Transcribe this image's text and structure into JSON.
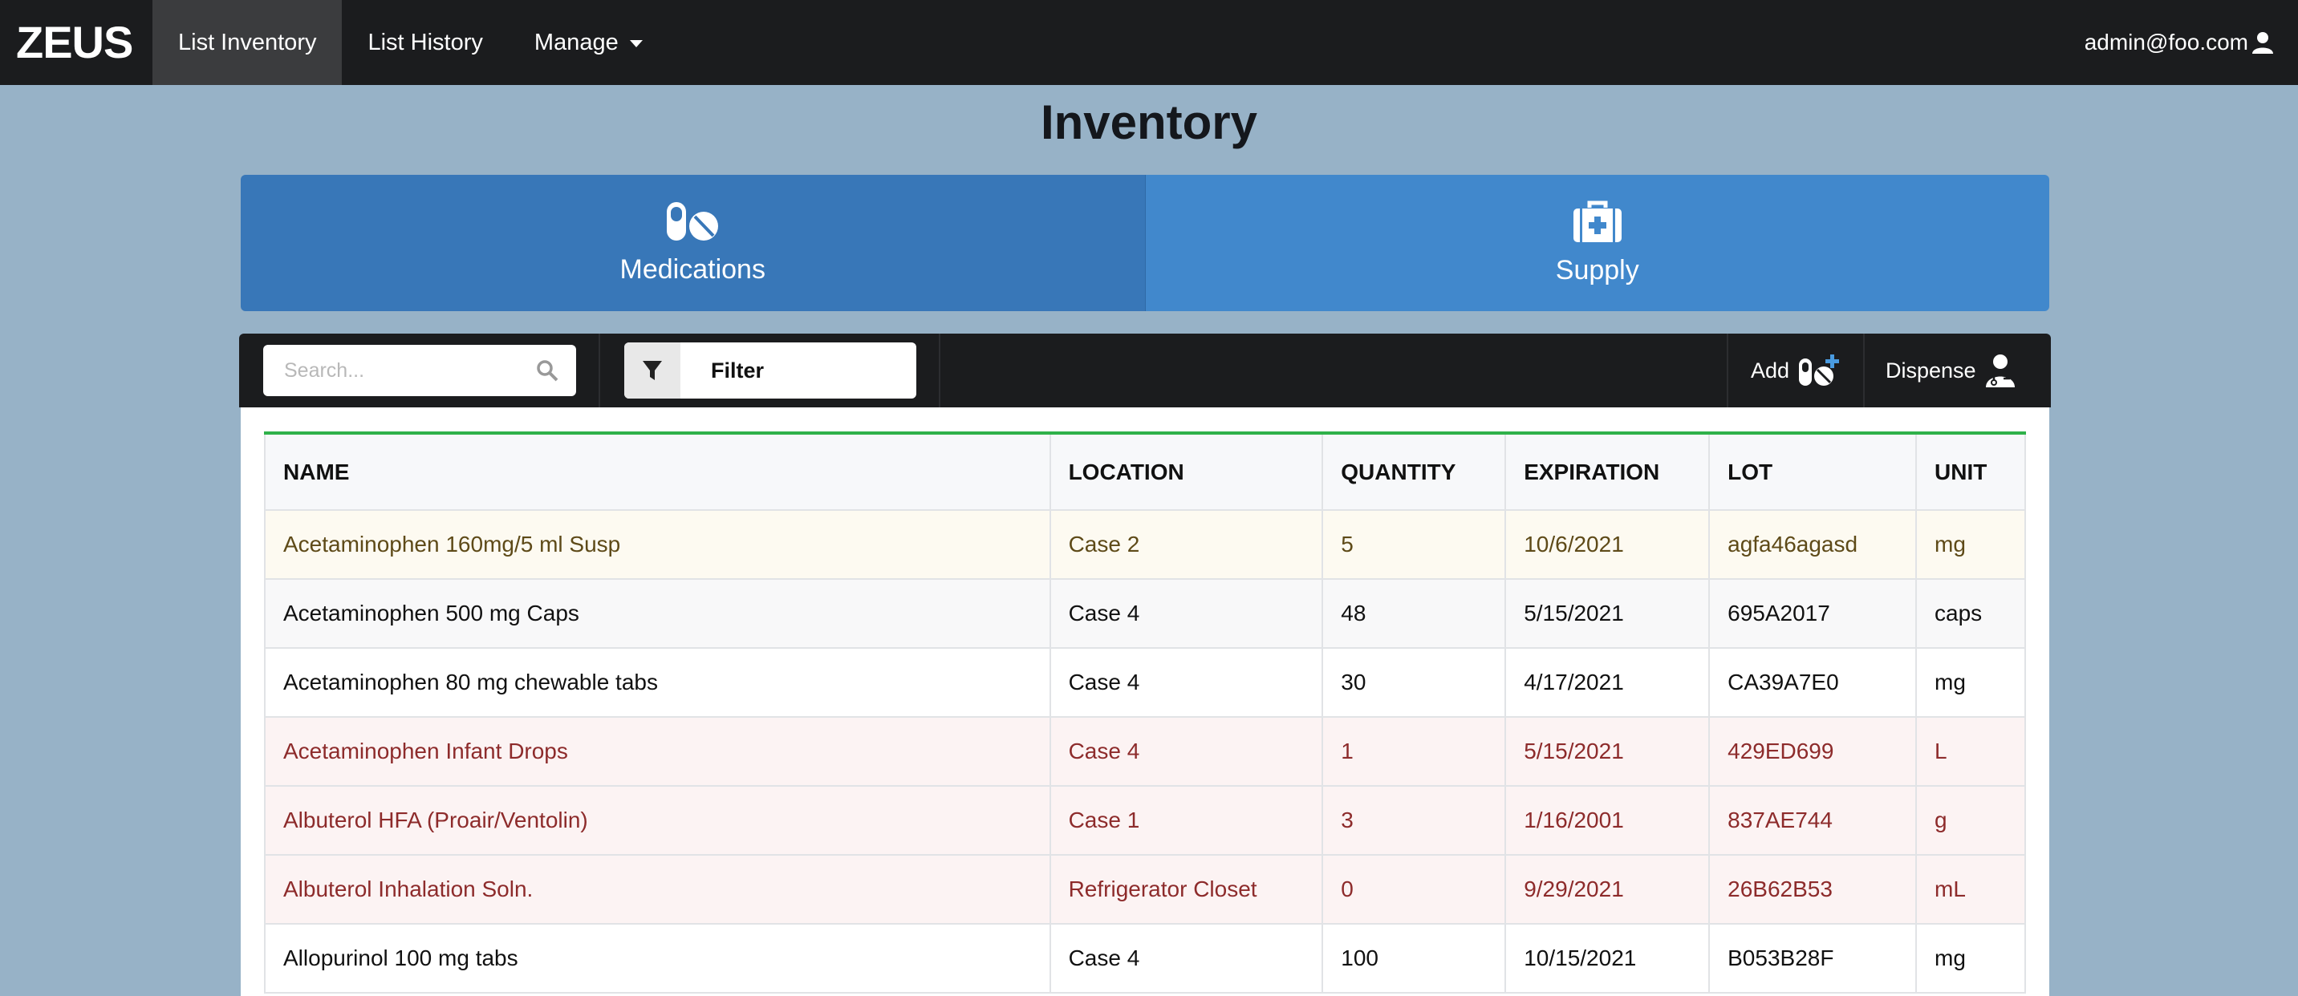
{
  "app": {
    "brand": "ZEUS",
    "user": "admin@foo.com"
  },
  "nav": {
    "items": [
      {
        "label": "List Inventory",
        "active": true
      },
      {
        "label": "List History",
        "active": false
      },
      {
        "label": "Manage",
        "active": false
      }
    ]
  },
  "page": {
    "title": "Inventory"
  },
  "categories": [
    {
      "label": "Medications",
      "icon": "pills-icon",
      "active": true
    },
    {
      "label": "Supply",
      "icon": "medkit-icon",
      "active": false
    }
  ],
  "toolbar": {
    "search_placeholder": "Search...",
    "filter_label": "Filter",
    "add_label": "Add",
    "dispense_label": "Dispense"
  },
  "table": {
    "headers": [
      "NAME",
      "LOCATION",
      "QUANTITY",
      "EXPIRATION",
      "LOT",
      "UNIT"
    ],
    "rows": [
      {
        "status": "warn",
        "cells": [
          "Acetaminophen 160mg/5 ml Susp",
          "Case 2",
          "5",
          "10/6/2021",
          "agfa46agasd",
          "mg"
        ]
      },
      {
        "status": "alt",
        "cells": [
          "Acetaminophen 500 mg Caps",
          "Case 4",
          "48",
          "5/15/2021",
          "695A2017",
          "caps"
        ]
      },
      {
        "status": "plain",
        "cells": [
          "Acetaminophen 80 mg chewable tabs",
          "Case 4",
          "30",
          "4/17/2021",
          "CA39A7E0",
          "mg"
        ]
      },
      {
        "status": "danger",
        "cells": [
          "Acetaminophen Infant Drops",
          "Case 4",
          "1",
          "5/15/2021",
          "429ED699",
          "L"
        ]
      },
      {
        "status": "danger",
        "cells": [
          "Albuterol HFA (Proair/Ventolin)",
          "Case 1",
          "3",
          "1/16/2001",
          "837AE744",
          "g"
        ]
      },
      {
        "status": "danger",
        "cells": [
          "Albuterol Inhalation Soln.",
          "Refrigerator Closet",
          "0",
          "9/29/2021",
          "26B62B53",
          "mL"
        ]
      },
      {
        "status": "plain",
        "cells": [
          "Allopurinol 100 mg tabs",
          "Case 4",
          "100",
          "10/15/2021",
          "B053B28F",
          "mg"
        ]
      }
    ]
  },
  "colors": {
    "navbar": "#1b1c1e",
    "background": "#97b2c7",
    "tab_active": "#3877b8",
    "tab_inactive": "#4188cc",
    "accent_green": "#2fb14a"
  }
}
